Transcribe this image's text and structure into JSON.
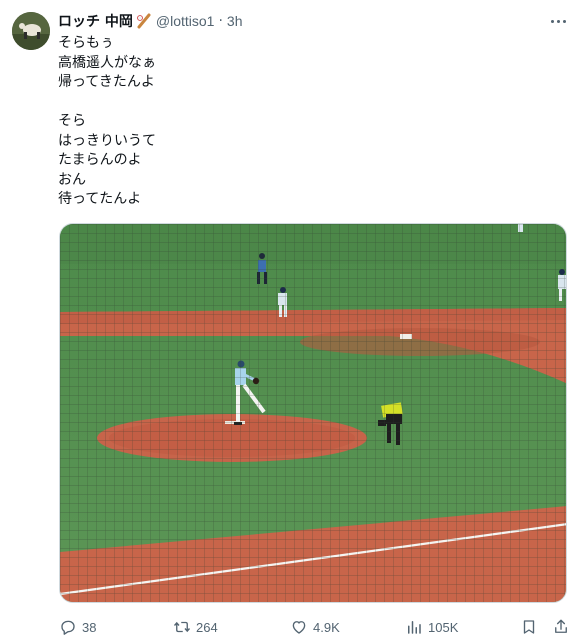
{
  "author": {
    "display_name": "ロッチ 中岡",
    "name_emoji": "bat-and-ball-emoji",
    "handle": "@lottiso1",
    "separator": "·",
    "time": "3h"
  },
  "tweet": {
    "lines": [
      "そらもぅ",
      "高橋遥人がなぁ",
      "帰ってきたんよ",
      "",
      "そら",
      "はっきりいうて",
      "たまらんのよ",
      "おん",
      "待ってたんよ"
    ]
  },
  "media": {
    "description_icon": "baseball-field-photo"
  },
  "actions": {
    "replies": "38",
    "reposts": "264",
    "likes": "4.9K",
    "views": "105K"
  },
  "colors": {
    "text_primary": "#0f1419",
    "text_secondary": "#536471",
    "grass": "#4f8a4c",
    "dirt": "#c9644a"
  }
}
